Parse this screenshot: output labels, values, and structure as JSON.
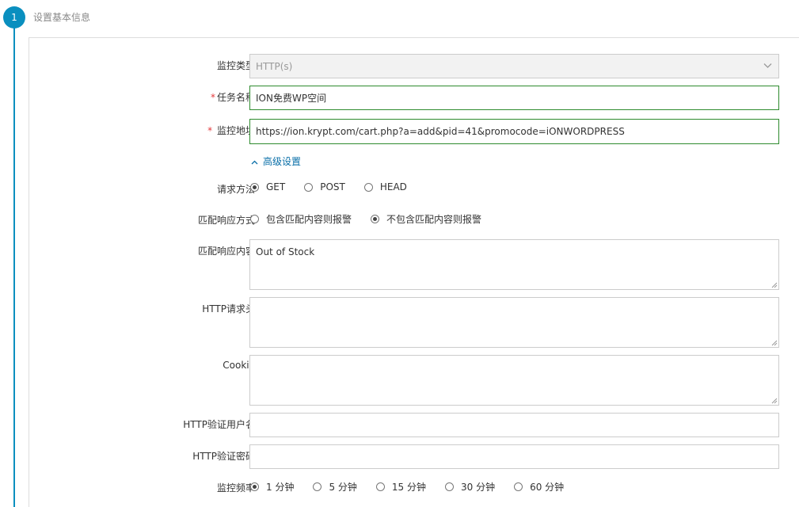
{
  "step": {
    "number": "1",
    "title": "设置基本信息"
  },
  "form": {
    "monitor_type": {
      "label": "监控类型",
      "value": "HTTP(s)"
    },
    "task_name": {
      "required_mark": "*",
      "label": "任务名称",
      "value": "ION免费WP空间"
    },
    "monitor_url": {
      "required_mark": "*",
      "label": "监控地址",
      "value": "https://ion.krypt.com/cart.php?a=add&pid=41&promocode=iONWORDPRESS"
    },
    "advanced_settings": {
      "label": "高级设置",
      "expanded": true
    },
    "request_method": {
      "label": "请求方法",
      "options": [
        "GET",
        "POST",
        "HEAD"
      ],
      "selected": "GET"
    },
    "match_mode": {
      "label": "匹配响应方式",
      "options": [
        "包含匹配内容则报警",
        "不包含匹配内容则报警"
      ],
      "selected": "不包含匹配内容则报警"
    },
    "match_content": {
      "label": "匹配响应内容",
      "value": "Out of Stock"
    },
    "http_headers": {
      "label": "HTTP请求头",
      "value": ""
    },
    "cookie": {
      "label": "Cookie",
      "value": ""
    },
    "http_auth_user": {
      "label": "HTTP验证用户名",
      "value": ""
    },
    "http_auth_password": {
      "label": "HTTP验证密码",
      "value": ""
    },
    "frequency": {
      "label": "监控频率",
      "options": [
        "1 分钟",
        "5 分钟",
        "15 分钟",
        "30 分钟",
        "60 分钟"
      ],
      "selected": "1 分钟"
    }
  },
  "colors": {
    "accent": "#0a8fbf",
    "valid_border": "#2e8b2e",
    "required": "#e4393c",
    "link": "#0a6fa8"
  }
}
